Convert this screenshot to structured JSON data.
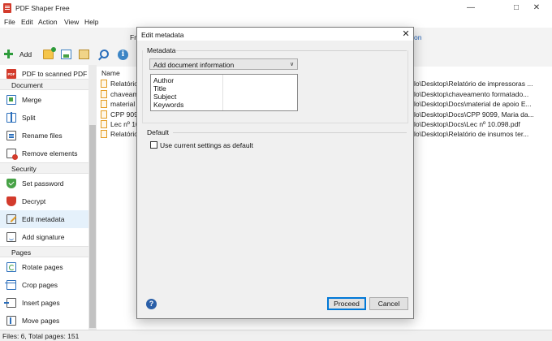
{
  "window": {
    "title": "PDF Shaper Free"
  },
  "menu": [
    "File",
    "Edit",
    "Action",
    "View",
    "Help"
  ],
  "toolbar": {
    "add_label": "Add",
    "bg_left_fragment": "Fr",
    "bg_right_fragment": "on"
  },
  "sidebar": {
    "top_item": "PDF to scanned PDF",
    "sections": [
      {
        "title": "Document",
        "items": [
          "Merge",
          "Split",
          "Rename files",
          "Remove elements"
        ]
      },
      {
        "title": "Security",
        "items": [
          "Set password",
          "Decrypt",
          "Edit metadata",
          "Add signature"
        ]
      },
      {
        "title": "Pages",
        "items": [
          "Rotate pages",
          "Crop pages",
          "Insert pages",
          "Move pages"
        ]
      }
    ],
    "active_item": "Edit metadata"
  },
  "filelist": {
    "column_name": "Name",
    "rows": [
      {
        "name": "Relatório d",
        "path": "lo\\Desktop\\Relatório de impressoras ..."
      },
      {
        "name": "chaveamen",
        "path": "lo\\Desktop\\chaveamento formatado..."
      },
      {
        "name": "material d",
        "path": "lo\\Desktop\\Docs\\material de apoio E..."
      },
      {
        "name": "CPP 9099,",
        "path": "lo\\Desktop\\Docs\\CPP 9099, Maria da..."
      },
      {
        "name": "Lec nº 10.",
        "path": "lo\\Desktop\\Docs\\Lec nº 10.098.pdf"
      },
      {
        "name": "Relatório d",
        "path": "lo\\Desktop\\Relatório de insumos ter..."
      }
    ]
  },
  "status": {
    "text": "Files: 6, Total pages: 151"
  },
  "dialog": {
    "title": "Edit metadata",
    "metadata_group": "Metadata",
    "combo_value": "Add document information",
    "fields": [
      "Author",
      "Title",
      "Subject",
      "Keywords"
    ],
    "default_group": "Default",
    "checkbox_label": "Use current settings as default",
    "checkbox_checked": false,
    "proceed_label": "Proceed",
    "cancel_label": "Cancel"
  }
}
